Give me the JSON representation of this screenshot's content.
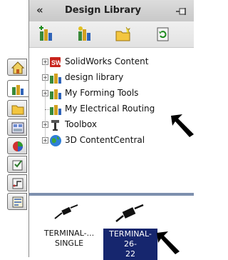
{
  "panel": {
    "title": "Design Library",
    "collapse_label": "«"
  },
  "toolbar": {
    "buttons": [
      {
        "icon": "add-to-library-icon"
      },
      {
        "icon": "add-file-location-icon"
      },
      {
        "icon": "create-new-folder-icon"
      },
      {
        "icon": "refresh-icon"
      }
    ]
  },
  "tree": {
    "items": [
      {
        "label": "SolidWorks Content",
        "expander": "+",
        "icon": "solidworks-content-icon"
      },
      {
        "label": "design library",
        "expander": "+",
        "icon": "library-folder-icon"
      },
      {
        "label": "My Forming Tools",
        "expander": "+",
        "icon": "library-folder-icon"
      },
      {
        "label": "My Electrical Routing",
        "expander": "",
        "icon": "library-folder-icon"
      },
      {
        "label": "Toolbox",
        "expander": "+",
        "icon": "toolbox-icon"
      },
      {
        "label": "3D ContentCentral",
        "expander": "+",
        "icon": "globe-icon"
      }
    ]
  },
  "preview": {
    "items": [
      {
        "line1": "TERMINAL-...",
        "line2": "SINGLE",
        "selected": false
      },
      {
        "line1": "TERMINAL-26-",
        "line2": "22",
        "selected": true
      }
    ]
  },
  "tabs": [
    {
      "name": "home-tab",
      "icon": "house-icon"
    },
    {
      "name": "design-library-tab",
      "icon": "design-library-icon"
    },
    {
      "name": "file-explorer-tab",
      "icon": "folder-icon"
    },
    {
      "name": "view-palette-tab",
      "icon": "view-palette-icon"
    },
    {
      "name": "appearances-tab",
      "icon": "appearances-icon"
    },
    {
      "name": "custom-properties-tab",
      "icon": "custom-properties-icon"
    },
    {
      "name": "routing-library-tab",
      "icon": "routing-library-icon"
    },
    {
      "name": "design-checker-tab",
      "icon": "design-checker-icon"
    }
  ],
  "colors": {
    "selection": "#16266e",
    "splitter": "#7d8fae"
  }
}
